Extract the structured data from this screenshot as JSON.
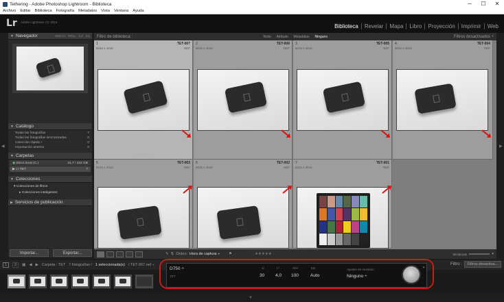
{
  "window": {
    "title": "Tethering - Adobe Photoshop Lightroom - Biblioteca",
    "controls": [
      "─",
      "☐",
      "✕"
    ]
  },
  "menu": [
    "Archivo",
    "Editar",
    "Biblioteca",
    "Fotografía",
    "Metadatos",
    "Vista",
    "Ventana",
    "Ayuda"
  ],
  "identity": {
    "logo": "Lr",
    "product": "Adobe Lightroom CC 2015"
  },
  "modules": [
    {
      "label": "Biblioteca",
      "active": true
    },
    {
      "label": "Revelar",
      "active": false
    },
    {
      "label": "Mapa",
      "active": false
    },
    {
      "label": "Libro",
      "active": false
    },
    {
      "label": "Proyección",
      "active": false
    },
    {
      "label": "Imprimir",
      "active": false
    },
    {
      "label": "Web",
      "active": false
    }
  ],
  "left_panel": {
    "navigator": {
      "title": "Navegador",
      "options": [
        "ENCAJ",
        "RELL",
        "1:1",
        "4:1"
      ]
    },
    "catalog": {
      "title": "Catálogo",
      "items": [
        {
          "label": "Todas las fotografías",
          "count": "7"
        },
        {
          "label": "Todas las fotografías sincronizadas",
          "count": "0"
        },
        {
          "label": "Colección rápida +",
          "count": "0"
        },
        {
          "label": "Importación anterior",
          "count": "0"
        }
      ]
    },
    "folders": {
      "title": "Carpetas",
      "disk": {
        "label": "Disco local (C:)",
        "info": "41,7 / 222 GB"
      },
      "folder": {
        "label": "TET",
        "count": "7"
      }
    },
    "collections": {
      "title": "Colecciones",
      "items": [
        "Colecciones de filtros",
        "Colecciones inteligentes"
      ]
    },
    "publish": {
      "title": "Servicios de publicación"
    },
    "import_label": "Importar...",
    "export_label": "Exportar..."
  },
  "filter_bar": {
    "title": "Filtro de biblioteca :",
    "options": [
      {
        "label": "Texto",
        "selected": false
      },
      {
        "label": "Atributo",
        "selected": false
      },
      {
        "label": "Metadatos",
        "selected": false
      },
      {
        "label": "Ninguno",
        "selected": true
      }
    ],
    "preset": "Filtros desactivados ÷"
  },
  "grid": [
    {
      "index": "1",
      "name": "TET-007",
      "dims": "6016 x 4016",
      "format": "NEF",
      "selected": true
    },
    {
      "index": "2",
      "name": "TET-006",
      "dims": "6016 x 4016",
      "format": "NEF",
      "selected": false
    },
    {
      "index": "3",
      "name": "TET-005",
      "dims": "6016 x 4016",
      "format": "NEF",
      "selected": false
    },
    {
      "index": "4",
      "name": "TET-004",
      "dims": "6016 x 4016",
      "format": "NEF",
      "selected": false
    },
    {
      "index": "5",
      "name": "TET-003",
      "dims": "6016 x 4016",
      "format": "NEF",
      "selected": false
    },
    {
      "index": "6",
      "name": "TET-002",
      "dims": "6016 x 4016",
      "format": "NEF",
      "selected": false
    },
    {
      "index": "7",
      "name": "TET-001",
      "dims": "6016 x 4016",
      "format": "NEF",
      "selected": false
    }
  ],
  "toolbar": {
    "sort_label": "Orden:",
    "sort_value": "Hora de captura ÷",
    "rating": "★★★★★",
    "size_label": "Miniaturas"
  },
  "filmstrip_bar": {
    "pages": [
      "1",
      "2"
    ],
    "path_label": "Carpeta : TET",
    "count_label": "7 fotografías /",
    "selected_label": "1 seleccionada(s)",
    "file_label": "/ TET-007.nef ÷",
    "filter_label": "Filtro :",
    "filter_value": "Filtros desactiva..."
  },
  "tether": {
    "camera": "D750 ÷",
    "session": "TET",
    "shutter_label": "1/",
    "shutter": "30",
    "aperture_label": "f /",
    "aperture": "4,0",
    "iso_label": "ISO",
    "iso": "100",
    "wb_label": "EB",
    "wb": "Auto",
    "develop_label": "Ajustes de revelado",
    "develop_value": "Ninguno ÷"
  }
}
